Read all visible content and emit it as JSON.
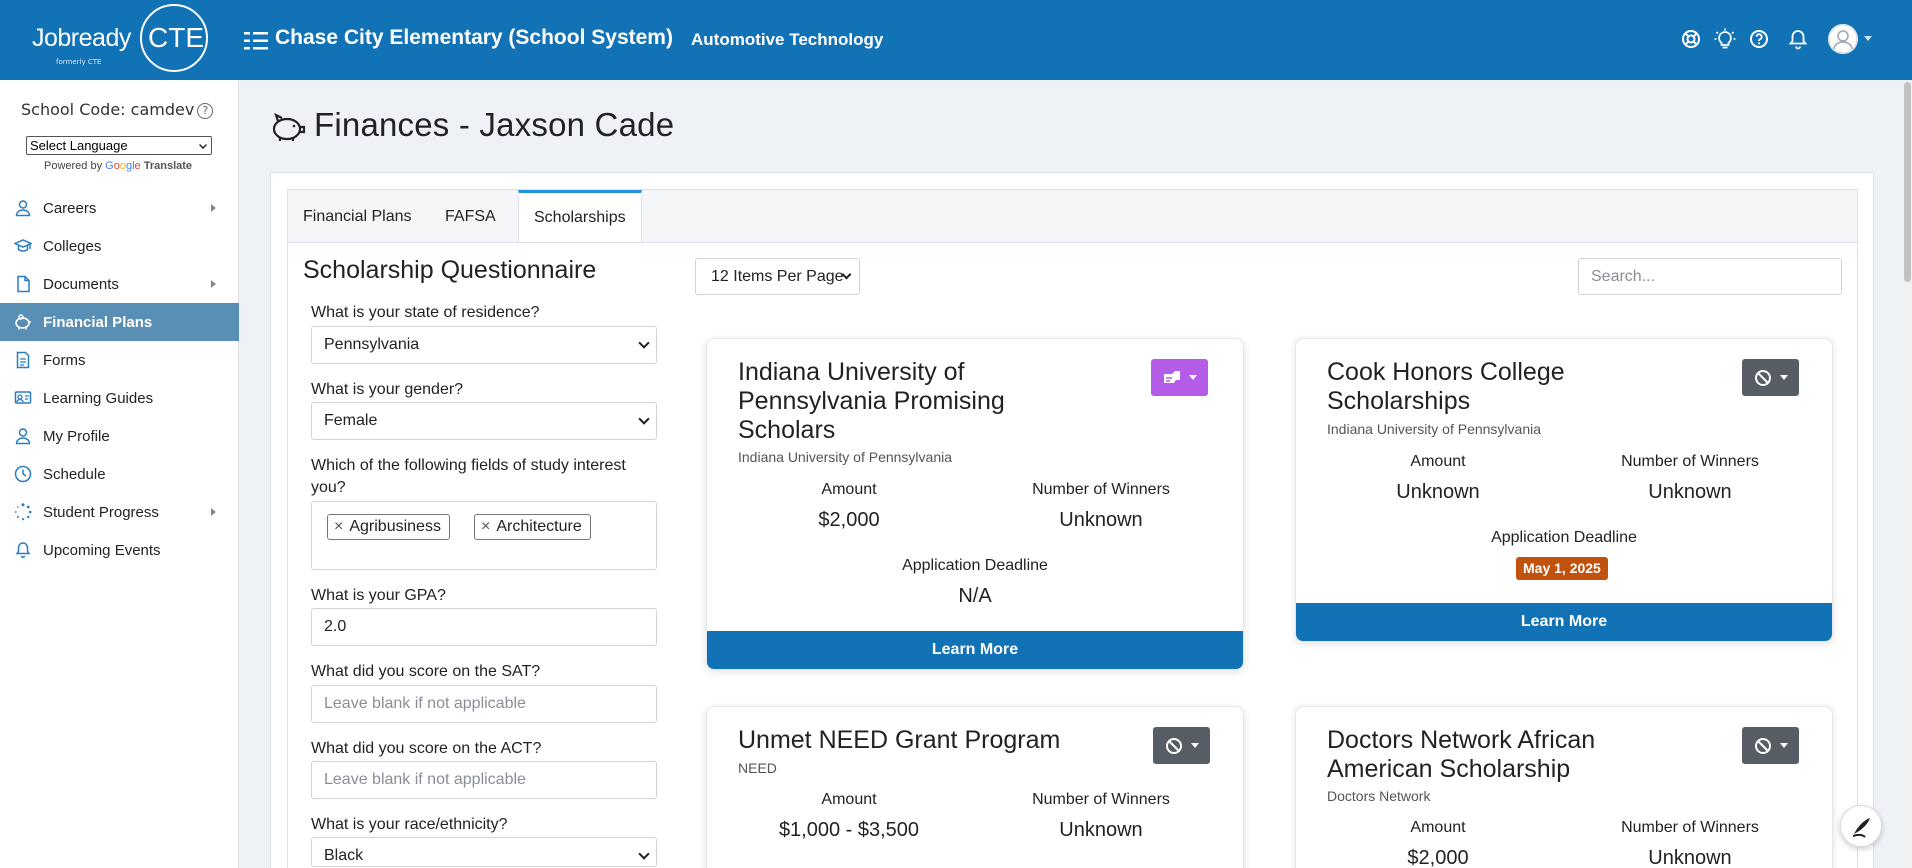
{
  "header": {
    "logo_word": "Jobready",
    "logo_cte": "CTE",
    "logo_sub": "formerly CTE",
    "org_title": "Chase City Elementary (School System)",
    "program_title": "Automotive Technology",
    "icons": [
      "lifebuoy-icon",
      "lightbulb-icon",
      "help-icon",
      "bell-icon",
      "user-avatar-icon"
    ]
  },
  "sidebar": {
    "school_code": "School Code: camdev",
    "language_select": "Select Language",
    "powered_by": "Powered by",
    "google": [
      "G",
      "o",
      "o",
      "g",
      "l",
      "e"
    ],
    "translate": "Translate",
    "items": [
      {
        "label": "Careers",
        "icon": "person-icon",
        "has_arrow": true,
        "active": false
      },
      {
        "label": "Colleges",
        "icon": "graduation-cap-icon",
        "has_arrow": false,
        "active": false
      },
      {
        "label": "Documents",
        "icon": "document-icon",
        "has_arrow": true,
        "active": false
      },
      {
        "label": "Financial Plans",
        "icon": "piggy-bank-icon",
        "has_arrow": false,
        "active": true
      },
      {
        "label": "Forms",
        "icon": "form-icon",
        "has_arrow": false,
        "active": false
      },
      {
        "label": "Learning Guides",
        "icon": "guide-icon",
        "has_arrow": false,
        "active": false
      },
      {
        "label": "My Profile",
        "icon": "person-icon",
        "has_arrow": false,
        "active": false
      },
      {
        "label": "Schedule",
        "icon": "clock-icon",
        "has_arrow": false,
        "active": false
      },
      {
        "label": "Student Progress",
        "icon": "progress-icon",
        "has_arrow": true,
        "active": false
      },
      {
        "label": "Upcoming Events",
        "icon": "bell-icon",
        "has_arrow": false,
        "active": false
      }
    ]
  },
  "page": {
    "title": "Finances - Jaxson Cade",
    "tabs": [
      "Financial Plans",
      "FAFSA",
      "Scholarships"
    ],
    "active_tab": "Scholarships"
  },
  "questionnaire": {
    "title": "Scholarship Questionnaire",
    "state_label": "What is your state of residence?",
    "state_value": "Pennsylvania",
    "gender_label": "What is your gender?",
    "gender_value": "Female",
    "fields_label": "Which of the following fields of study interest you?",
    "fields_chips": [
      "Agribusiness",
      "Architecture"
    ],
    "chip_remove": "×",
    "gpa_label": "What is your GPA?",
    "gpa_value": "2.0",
    "sat_label": "What did you score on the SAT?",
    "sat_placeholder": "Leave blank if not applicable",
    "act_label": "What did you score on the ACT?",
    "act_placeholder": "Leave blank if not applicable",
    "race_label": "What is your race/ethnicity?",
    "race_value": "Black"
  },
  "list_controls": {
    "per_page": "12 Items Per Page",
    "search_placeholder": "Search..."
  },
  "labels": {
    "amount": "Amount",
    "winners": "Number of Winners",
    "deadline": "Application Deadline",
    "learn_more": "Learn More"
  },
  "scholarships": [
    {
      "title": "Indiana University of Pennsylvania Promising Scholars",
      "org": "Indiana University of Pennsylvania",
      "amount": "$2,000",
      "winners": "Unknown",
      "deadline": "N/A",
      "action_color": "#b45ce8"
    },
    {
      "title": "Cook Honors College Scholarships",
      "org": "Indiana University of Pennsylvania",
      "amount": "Unknown",
      "winners": "Unknown",
      "deadline": "May 1, 2025",
      "action_color": "#565d64"
    },
    {
      "title": "Unmet NEED Grant Program",
      "org": "NEED",
      "amount": "$1,000 - $3,500",
      "winners": "Unknown",
      "action_color": "#565d64"
    },
    {
      "title": "Doctors Network African American Scholarship",
      "org": "Doctors Network",
      "amount": "$2,000",
      "winners": "Unknown",
      "action_color": "#565d64"
    }
  ],
  "colors": {
    "brand": "#1272b6",
    "sidebar_active": "#5a8fb5",
    "tab_accent": "#1f95dd",
    "deadline_badge": "#c0520d"
  }
}
